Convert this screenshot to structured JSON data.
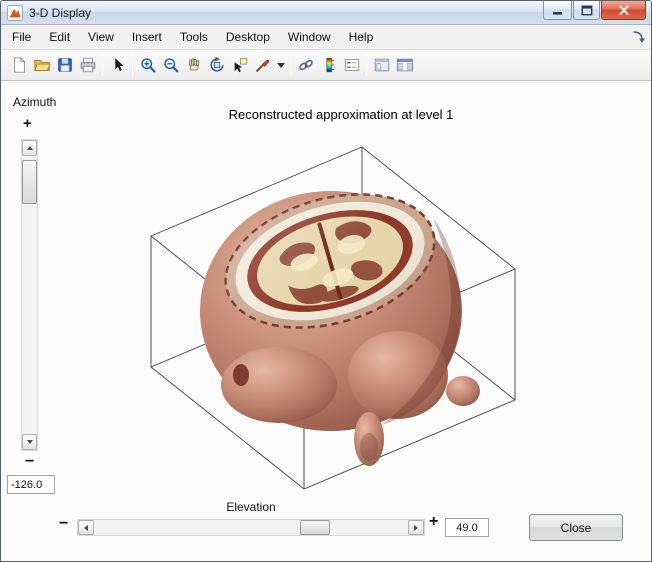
{
  "window": {
    "title": "3-D Display"
  },
  "menu": {
    "items": [
      "File",
      "Edit",
      "View",
      "Insert",
      "Tools",
      "Desktop",
      "Window",
      "Help"
    ]
  },
  "toolbar": {
    "icons": [
      "new-figure",
      "open-file",
      "save-figure",
      "print-figure",
      "select-arrow",
      "zoom-in",
      "zoom-out",
      "pan",
      "rotate-3d",
      "data-cursor",
      "brush-data",
      "brush-dropdown",
      "link-plot",
      "insert-colorbar",
      "insert-legend",
      "hide-plot-tools",
      "show-plot-tools"
    ]
  },
  "plot": {
    "title": "Reconstructed approximation at level 1"
  },
  "controls": {
    "azimuth": {
      "label": "Azimuth",
      "increase": "+",
      "decrease": "−",
      "value": "-126.0"
    },
    "elevation": {
      "label": "Elevation",
      "increase": "+",
      "decrease": "−",
      "value": "49.0"
    },
    "close_label": "Close"
  },
  "colors": {
    "skin": "#c68f7a",
    "cut_cream": "#f0e9d8",
    "brain_dark": "#8d3626",
    "brain_light": "#e6d6ab",
    "titlebar_close": "#d95b41"
  }
}
